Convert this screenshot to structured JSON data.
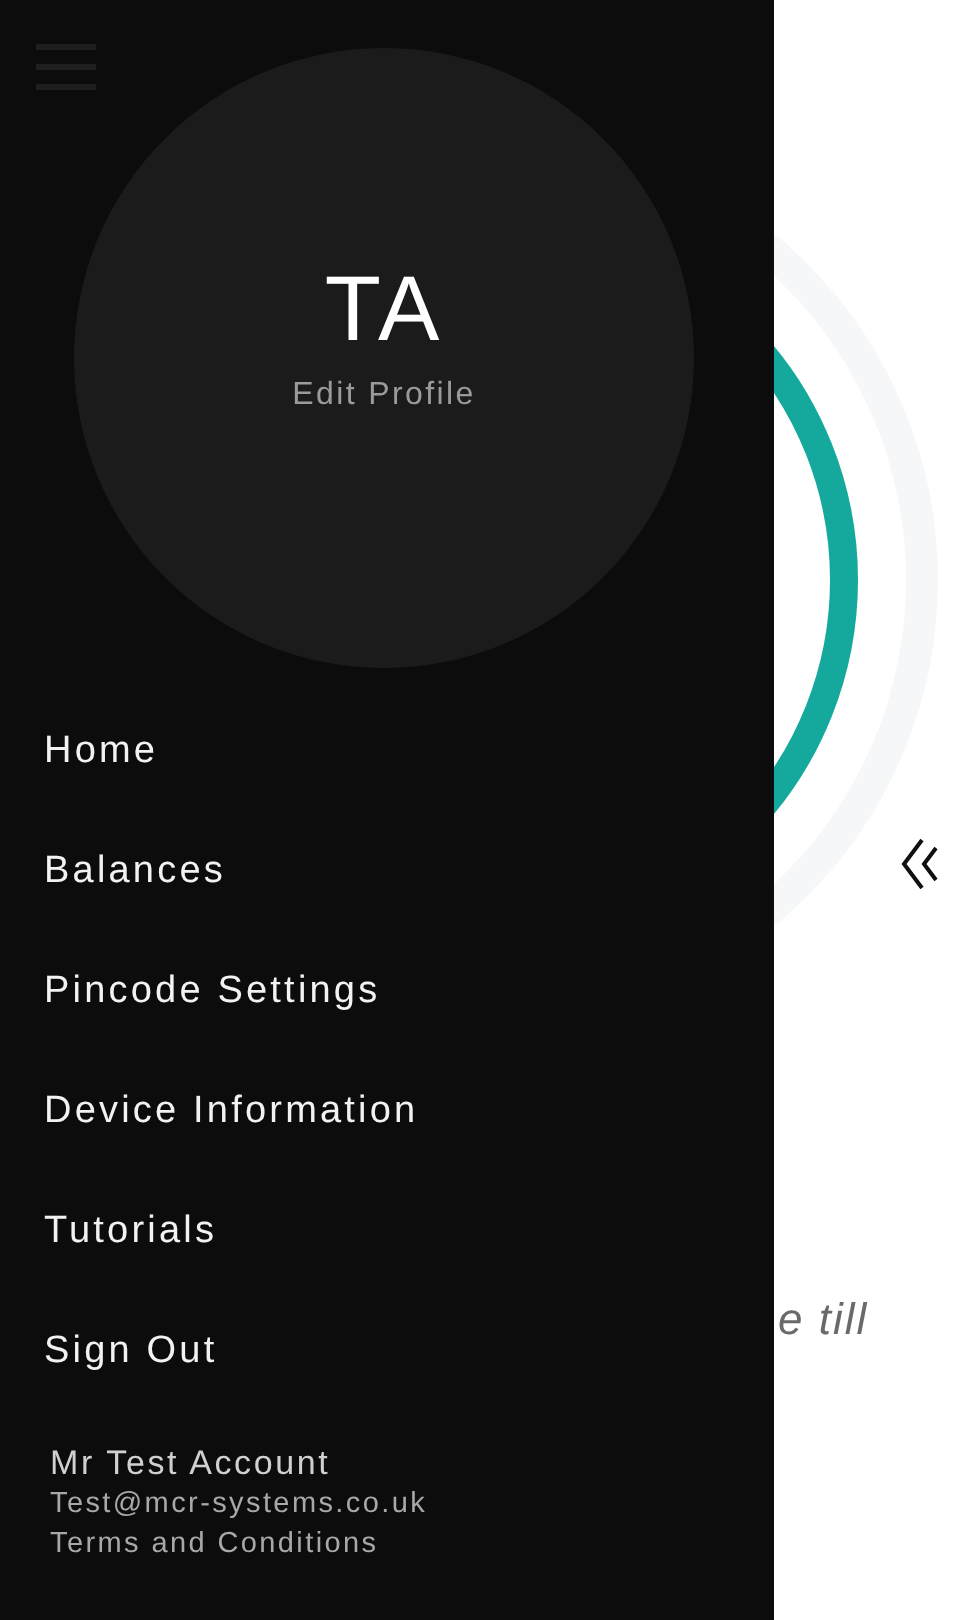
{
  "drawer": {
    "profile": {
      "initials": "TA",
      "edit_label": "Edit Profile"
    },
    "menu": [
      {
        "label": "Home"
      },
      {
        "label": "Balances"
      },
      {
        "label": "Pincode Settings"
      },
      {
        "label": "Device Information"
      },
      {
        "label": "Tutorials"
      },
      {
        "label": "Sign Out"
      }
    ],
    "account": {
      "name": "Mr Test Account",
      "email": "Test@mcr-systems.co.uk",
      "terms": "Terms and Conditions"
    }
  },
  "page": {
    "caption": "e till"
  }
}
